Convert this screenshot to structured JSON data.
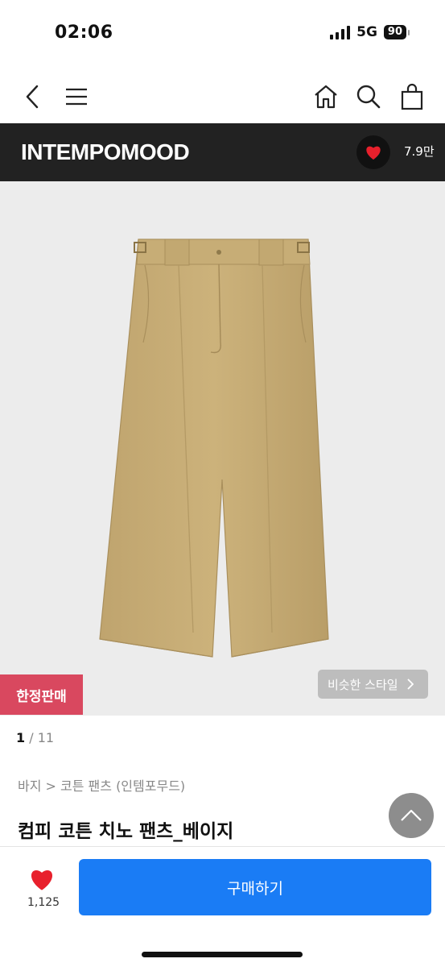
{
  "status": {
    "time": "02:06",
    "network": "5G",
    "battery": "90"
  },
  "nav": {
    "icons": [
      "back-icon",
      "menu-icon",
      "home-icon",
      "search-icon",
      "shopping-bag-icon"
    ]
  },
  "brand": {
    "name": "INTEMPOMOOD",
    "likes": "7.9만"
  },
  "colors": {
    "brand_bar": "#222222",
    "heart": "#e8202c",
    "badge": "#d9485f",
    "buy_button": "#1a7cf5",
    "product": "#c9ae77"
  },
  "product": {
    "limited_badge": "한정판매",
    "similar_label": "비슷한 스타일",
    "page_current": "1",
    "page_total": " / 11",
    "breadcrumb": "바지 > 코튼 팬츠 (인템포무드)",
    "title": "컴피 코튼 치노 팬츠_베이지"
  },
  "actions": {
    "like_count": "1,125",
    "buy_label": "구매하기"
  }
}
